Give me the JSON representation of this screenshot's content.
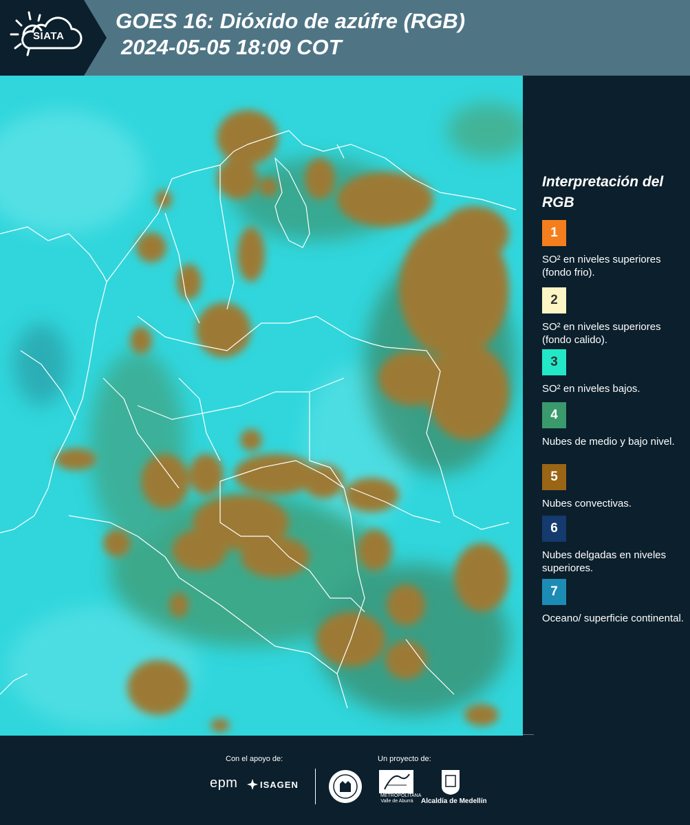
{
  "header": {
    "logo_text": "SIATA",
    "title_line1": "GOES 16: Dióxido de azúfre (RGB)",
    "title_line2": "2024-05-05 18:09 COT"
  },
  "map": {
    "background_color": "#30d6dc",
    "cloud_color": "#9c7a36",
    "border_color": "#ffffff"
  },
  "legend": {
    "title": "Interpretación del RGB",
    "items": [
      {
        "number": "1",
        "color": "#f47e1e",
        "text_color": "#ffffff",
        "label": "SO² en niveles superiores (fondo frio)."
      },
      {
        "number": "2",
        "color": "#fdf6c4",
        "text_color": "#333333",
        "label": "SO² en niveles superiores (fondo calido)."
      },
      {
        "number": "3",
        "color": "#22e8c8",
        "text_color": "#333333",
        "label": "SO² en niveles bajos."
      },
      {
        "number": "4",
        "color": "#3a9a6c",
        "text_color": "#ffffff",
        "label": "Nubes de medio y bajo nivel."
      },
      {
        "number": "5",
        "color": "#9a6514",
        "text_color": "#ffffff",
        "label": "Nubes convectivas."
      },
      {
        "number": "6",
        "color": "#143a6e",
        "text_color": "#ffffff",
        "label": "Nubes delgadas en niveles superiores."
      },
      {
        "number": "7",
        "color": "#1d8cb4",
        "text_color": "#ffffff",
        "label": "Oceano/ superficie continental."
      }
    ]
  },
  "footer": {
    "support_label": "Con el apoyo de:",
    "project_label": "Un proyecto de:",
    "epm_text": "epm",
    "isagen_text": "ISAGEN",
    "alcaldia_text": "Alcaldía de Medellín",
    "metro_text": "METROPOLITANA Valle de Aburrá"
  }
}
